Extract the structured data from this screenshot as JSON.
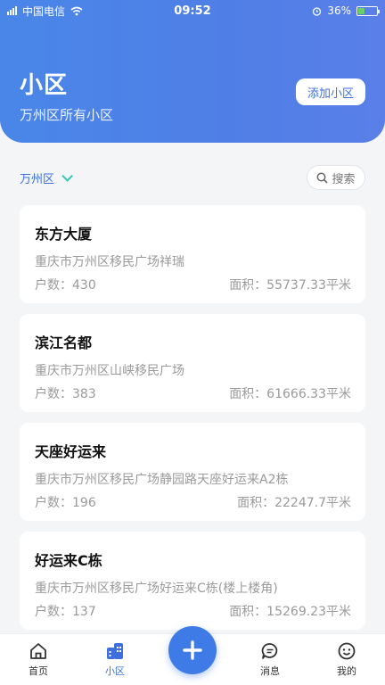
{
  "status_bar": {
    "carrier": "中国电信",
    "time": "09:52",
    "battery": "36%",
    "battery_level": 0.36
  },
  "header": {
    "title": "小区",
    "subtitle": "万州区所有小区",
    "add_button_label": "添加小区"
  },
  "filter": {
    "district": "万州区",
    "search_label": "搜索"
  },
  "communities": [
    {
      "name": "东方大厦",
      "address": "重庆市万州区移民广场祥瑞",
      "households": "户数：430",
      "area": "面积：55737.33平米"
    },
    {
      "name": "滨江名都",
      "address": "重庆市万州区山峡移民广场",
      "households": "户数：383",
      "area": "面积：61666.33平米"
    },
    {
      "name": "天座好运来",
      "address": "重庆市万州区移民广场静园路天座好运来A2栋",
      "households": "户数：196",
      "area": "面积：22247.7平米"
    },
    {
      "name": "好运来C栋",
      "address": "重庆市万州区移民广场好运来C栋(楼上楼角)",
      "households": "户数：137",
      "area": "面积：15269.23平米"
    }
  ],
  "tabs": [
    {
      "label": "首页",
      "icon": "home-icon"
    },
    {
      "label": "小区",
      "icon": "community-icon"
    },
    {
      "label": "消息",
      "icon": "message-icon"
    },
    {
      "label": "我的",
      "icon": "profile-icon"
    }
  ],
  "colors": {
    "accent": "#3f6fde",
    "header_gradient_start": "#4a86e8",
    "background": "#f4f5f7"
  }
}
